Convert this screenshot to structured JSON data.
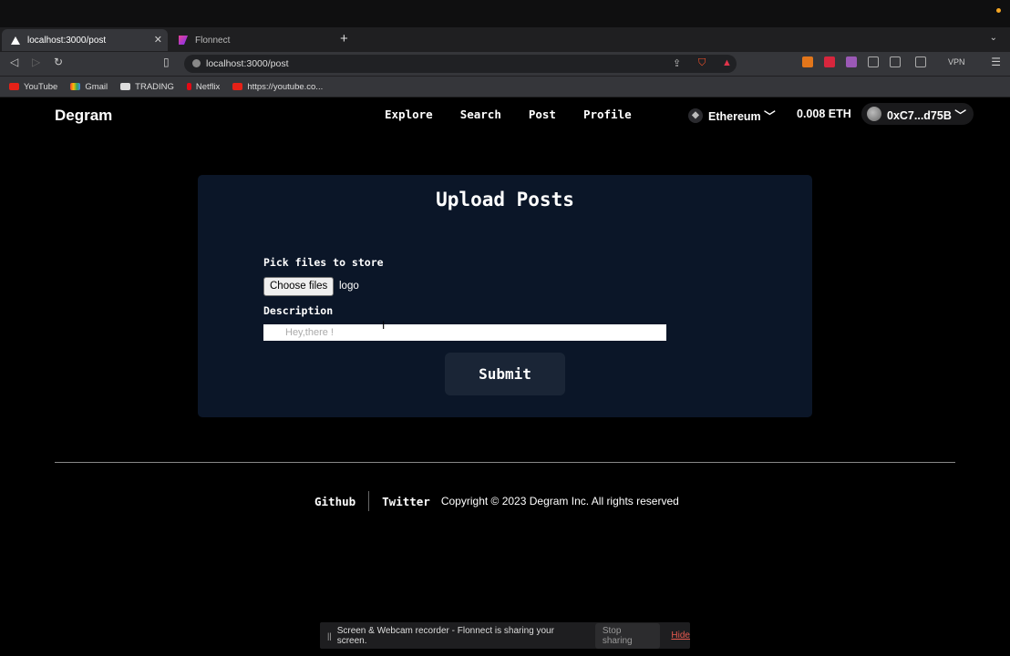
{
  "browser": {
    "tabs": [
      {
        "title": "localhost:3000/post",
        "icon": "triangle-icon"
      },
      {
        "title": "Flonnect",
        "icon": "flonnect-icon"
      }
    ],
    "new_tab": "+",
    "url": "localhost:3000/post",
    "vpn_label": "VPN",
    "bookmarks": [
      {
        "label": "YouTube",
        "icon": "youtube-icon"
      },
      {
        "label": "Gmail",
        "icon": "gmail-icon"
      },
      {
        "label": "TRADING",
        "icon": "tradingview-icon"
      },
      {
        "label": "Netflix",
        "icon": "netflix-icon"
      },
      {
        "label": "https://youtube.co...",
        "icon": "youtube-icon"
      }
    ]
  },
  "app": {
    "brand": "Degram",
    "nav": [
      "Explore",
      "Search",
      "Post",
      "Profile"
    ],
    "network": "Ethereum ﹀",
    "balance": "0.008 ETH",
    "account": "0xC7...d75B ﹀"
  },
  "upload": {
    "title": "Upload Posts",
    "pick_label": "Pick files to store",
    "choose_button": "Choose files",
    "chosen_file": "logo",
    "description_label": "Description",
    "description_placeholder": "Hey,there !",
    "submit_label": "Submit"
  },
  "footer": {
    "links": [
      "Github",
      "Twitter"
    ],
    "copyright": "Copyright © 2023 Degram Inc. All rights reserved"
  },
  "share_bar": {
    "message": "Screen & Webcam recorder - Flonnect is sharing your screen.",
    "stop_label": "Stop sharing",
    "hide_label": "Hide"
  },
  "colors": {
    "card_bg": "#0b1628",
    "submit_bg": "#1a2536",
    "hide_link": "#e85a4f"
  }
}
